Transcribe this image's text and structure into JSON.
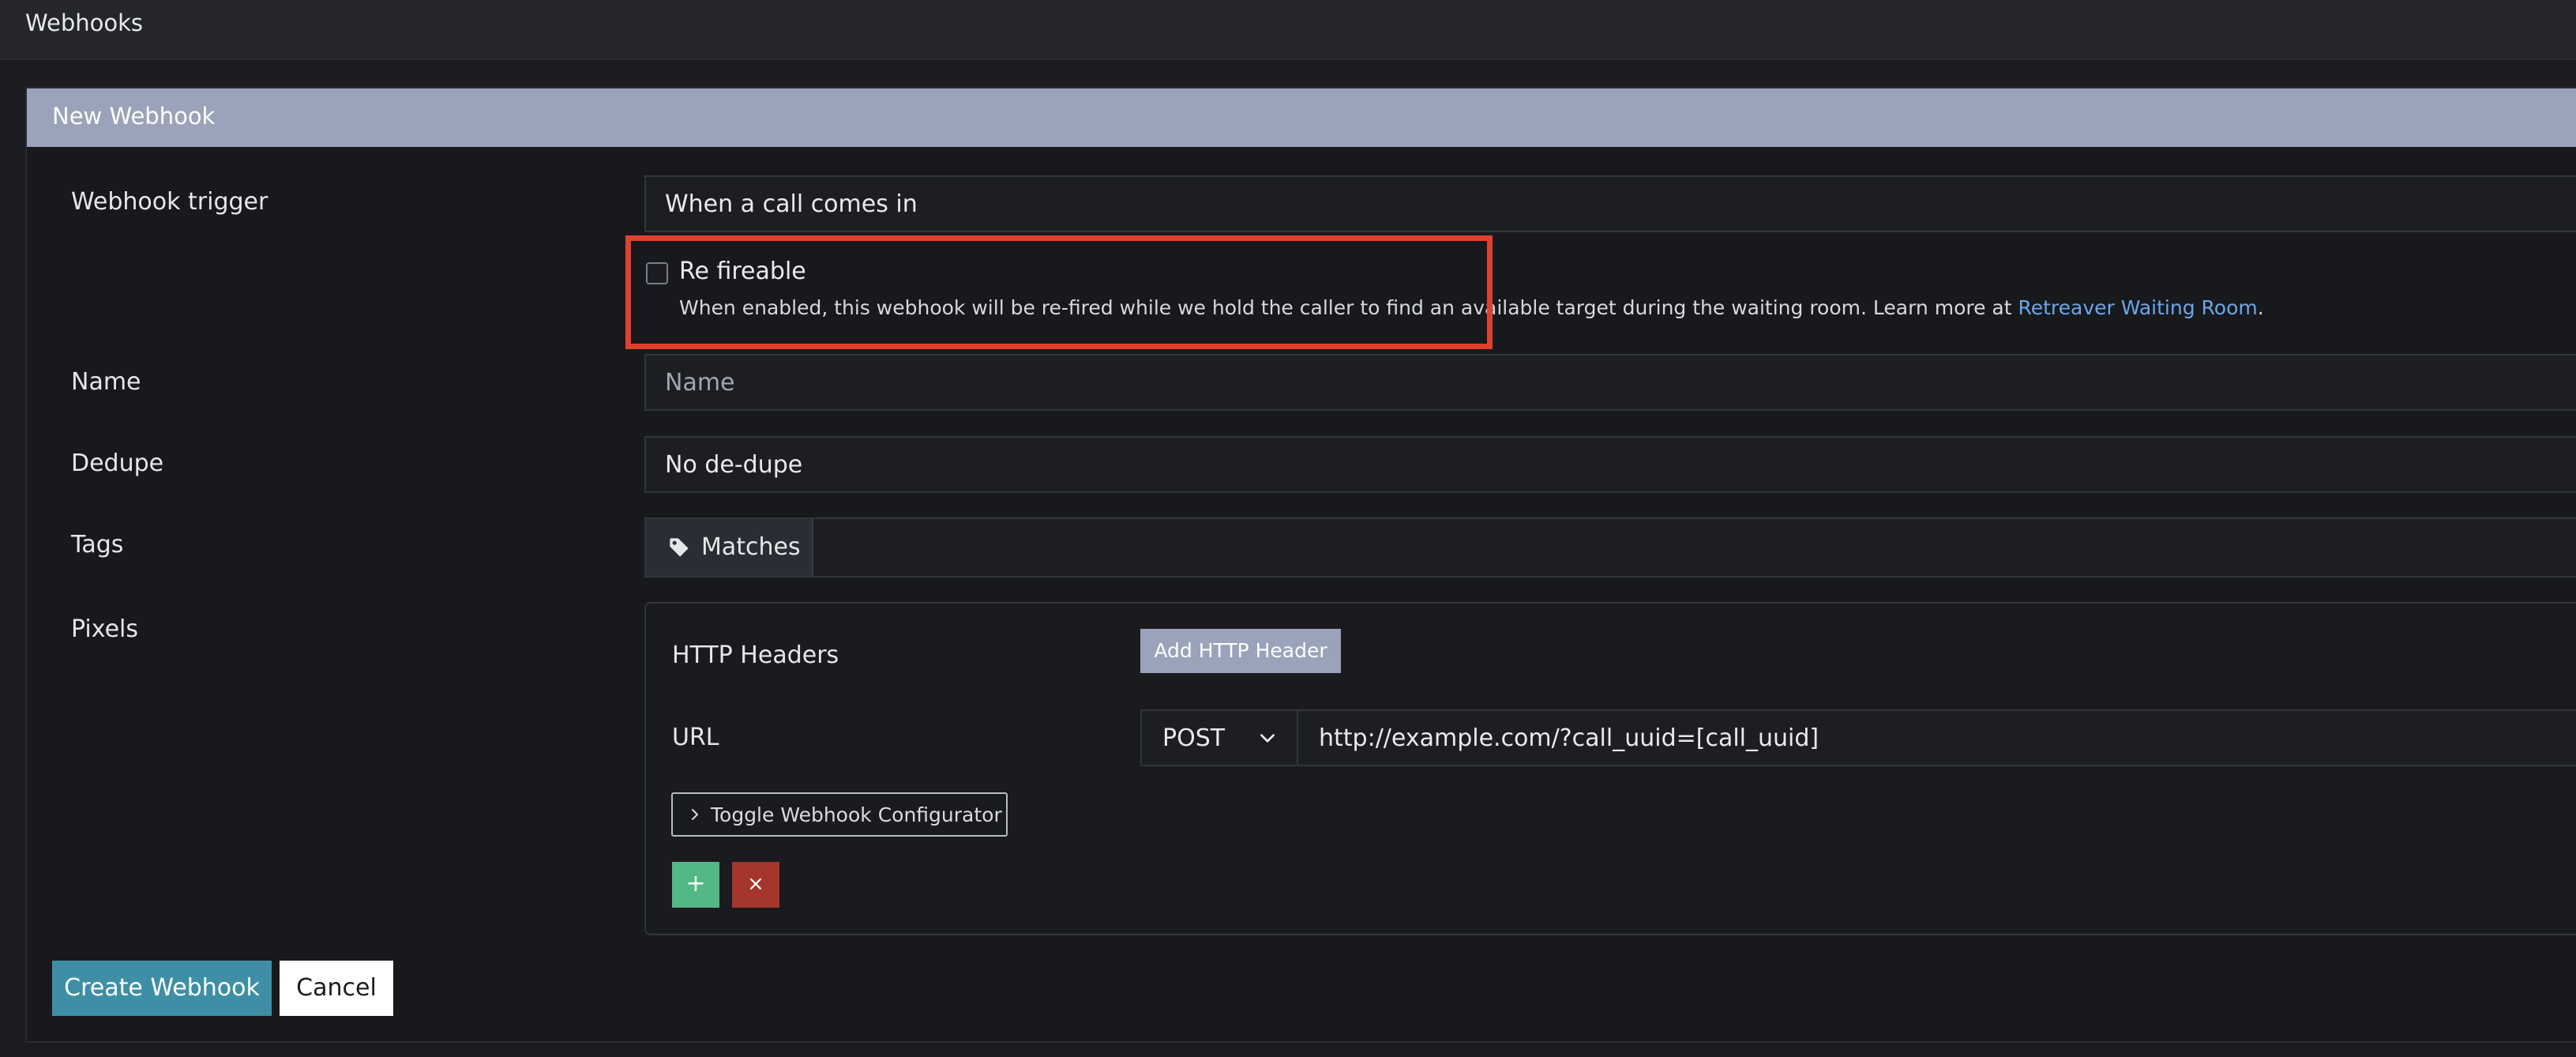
{
  "topbar": {
    "title": "Webhooks"
  },
  "panel": {
    "title": "New Webhook"
  },
  "form": {
    "trigger": {
      "label": "Webhook trigger",
      "value": "When a call comes in"
    },
    "refireable": {
      "label": "Re fireable",
      "checked": false,
      "help_text": "When enabled, this webhook will be re-fired while we hold the caller to find an available target during the waiting room. Learn more at ",
      "link_text": "Retreaver Waiting Room",
      "help_suffix": "."
    },
    "name": {
      "label": "Name",
      "placeholder": "Name"
    },
    "dedupe": {
      "label": "Dedupe",
      "value": "No de-dupe"
    },
    "tags": {
      "label": "Tags",
      "button_label": "Matches",
      "icon": "tag-icon"
    },
    "pixels": {
      "label": "Pixels",
      "http_headers_label": "HTTP Headers",
      "add_header_label": "Add HTTP Header",
      "url_label": "URL",
      "method": "POST",
      "url_value": "http://example.com/?call_uuid=[call_uuid]",
      "toggle_label": "Toggle Webhook Configurator",
      "add_symbol": "+",
      "remove_symbol": "×"
    }
  },
  "actions": {
    "create_label": "Create Webhook",
    "cancel_label": "Cancel"
  },
  "annotation": {
    "highlight_color": "#e0412e"
  },
  "colors": {
    "header_bg": "#9aa3b9",
    "primary": "#3e8fa5",
    "add_green": "#52b886",
    "remove_red": "#a5362b",
    "link": "#6aa7e8"
  }
}
